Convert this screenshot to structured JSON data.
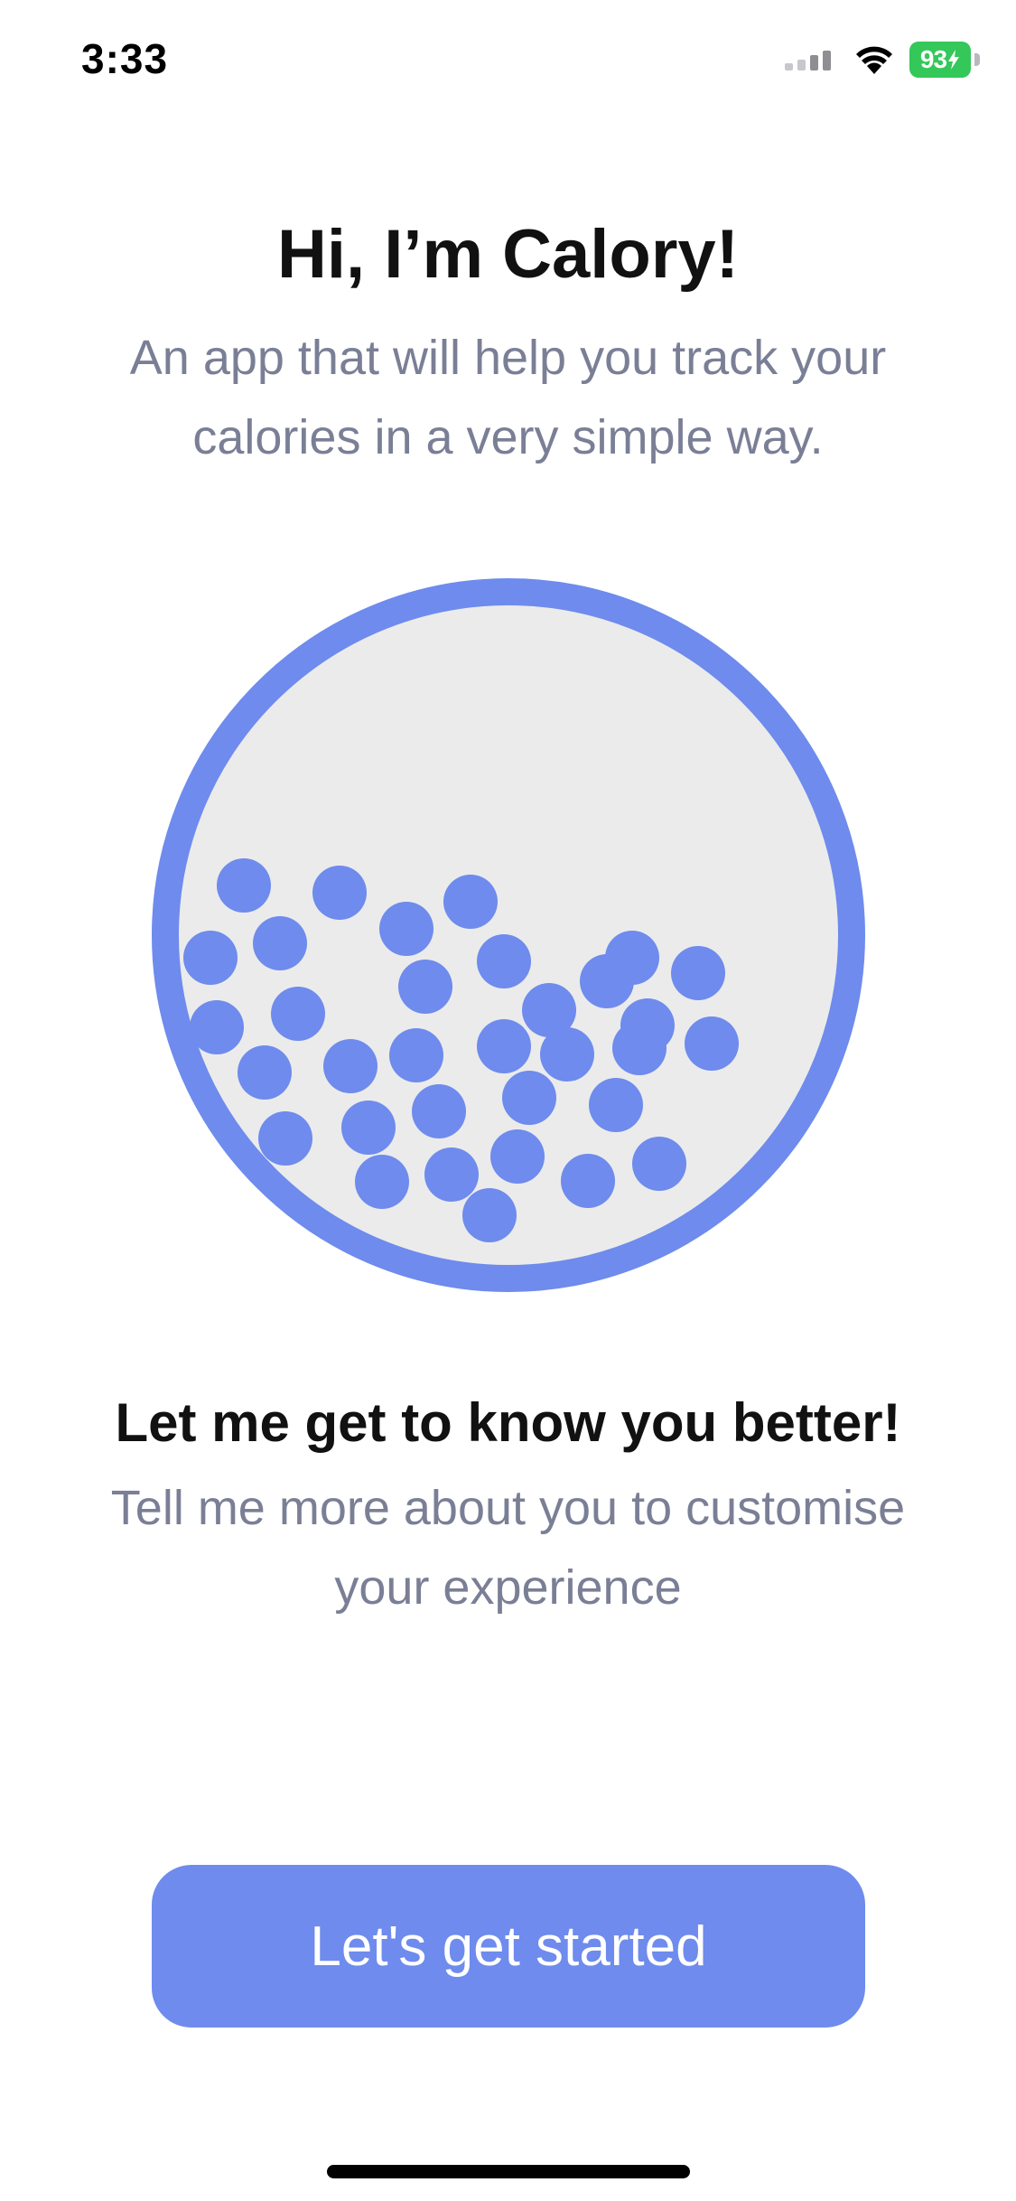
{
  "status_bar": {
    "time": "3:33",
    "battery": "93",
    "icons": [
      "cellular-signal-icon",
      "wifi-icon",
      "battery-charging-icon"
    ],
    "battery_color": "#34c759"
  },
  "intro": {
    "title": "Hi, I’m Calory!",
    "subtitle": "An app that will help you track your calories in a very simple way."
  },
  "illustration": {
    "icon": "calorie-bowl-icon",
    "ring_color": "#6e8bed",
    "fill_color": "#ebebeb",
    "ball_color": "#6e8bed"
  },
  "onboarding": {
    "title": "Let me get to know you better!",
    "subtitle": "Tell me more about you to customise your experience"
  },
  "actions": {
    "start_label": "Let's get started",
    "accent_color": "#6e8bed"
  }
}
